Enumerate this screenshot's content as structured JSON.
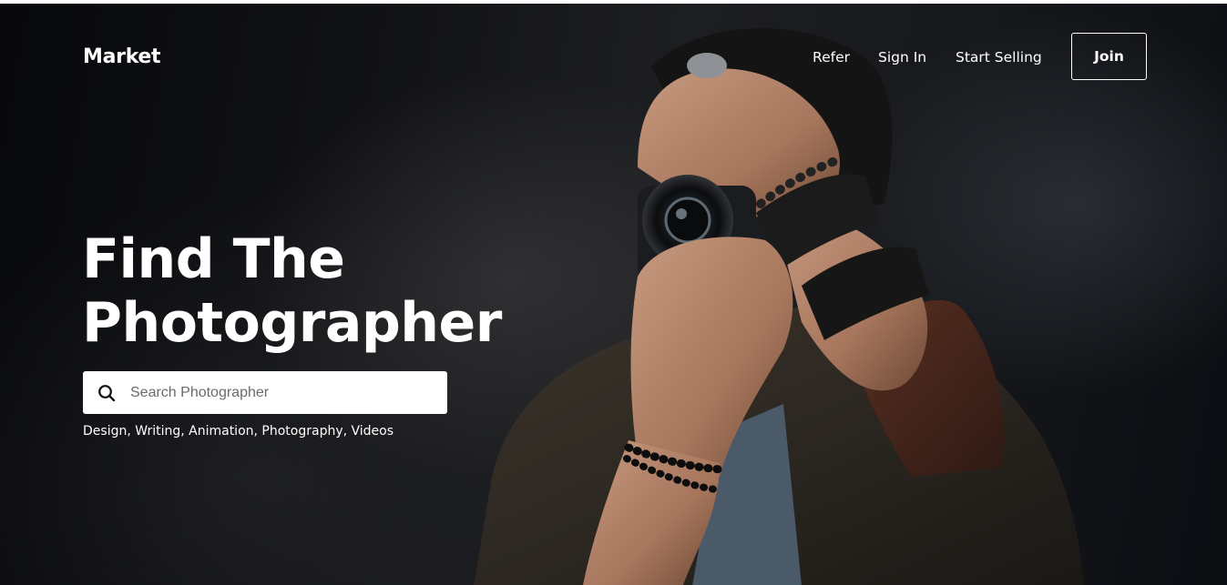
{
  "nav": {
    "brand": "Market",
    "links": [
      "Refer",
      "Sign In",
      "Start Selling"
    ],
    "join_label": "Join"
  },
  "hero": {
    "headline_line1": "Find The",
    "headline_line2": "Photographer",
    "search": {
      "placeholder": "Search Photographer",
      "icon": "search-icon"
    },
    "categories": "Design, Writing, Animation, Photography, Videos"
  },
  "colors": {
    "background": "#0f1013",
    "text": "#ffffff",
    "search_bg": "#ffffff",
    "search_icon": "#111111"
  }
}
